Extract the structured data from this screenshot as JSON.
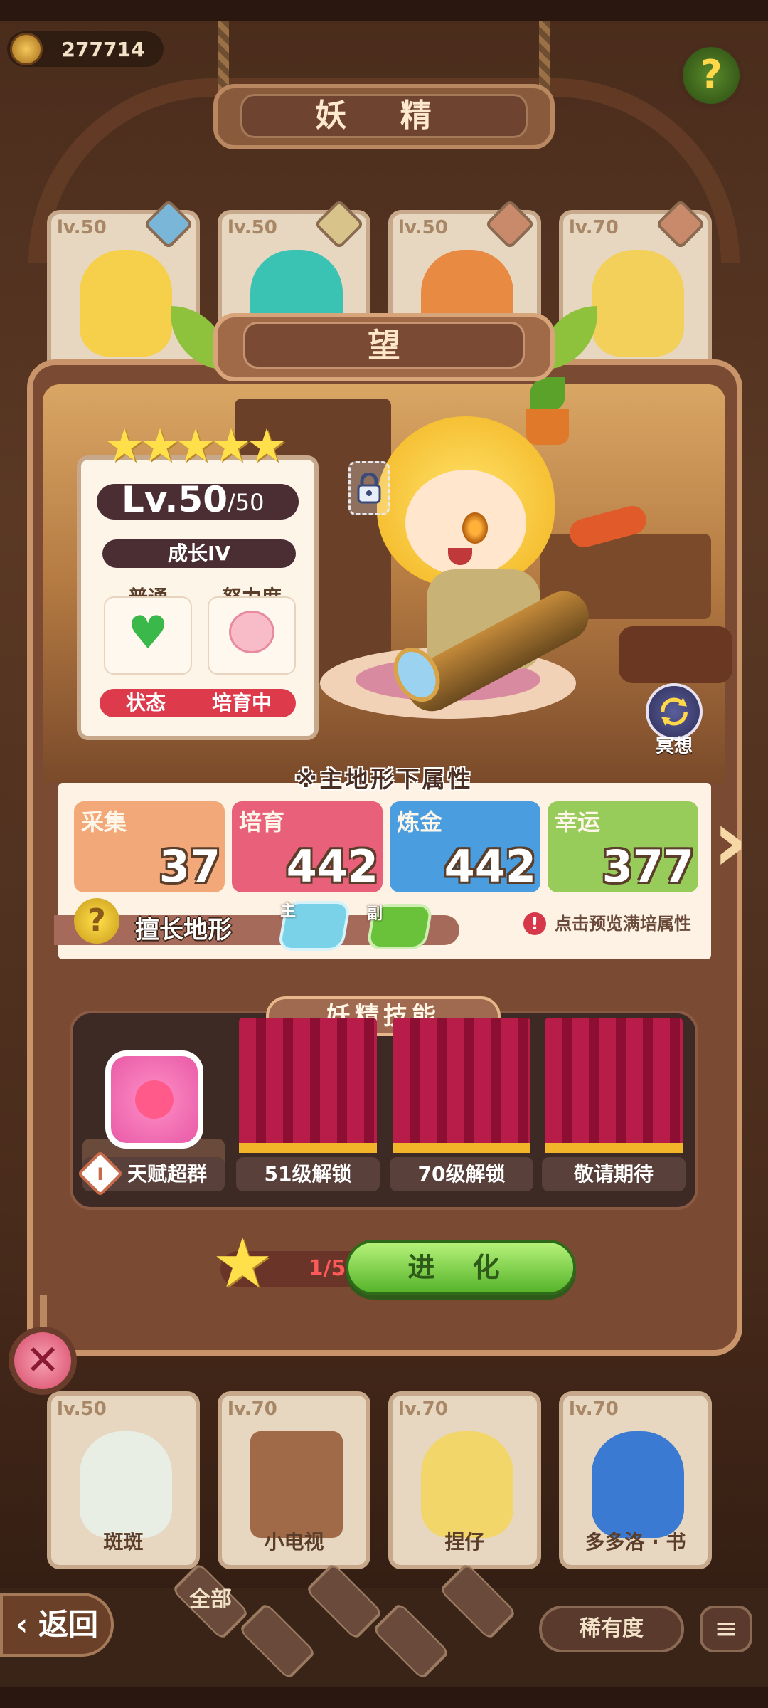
{
  "header": {
    "coins": "277714",
    "title": "妖 精",
    "help_icon": "question-mark-sprout-icon"
  },
  "background_cards_top": [
    {
      "level": "lv.50"
    },
    {
      "level": "lv.50"
    },
    {
      "level": "lv.50"
    },
    {
      "level": "lv.70"
    }
  ],
  "background_cards_bottom": [
    {
      "level": "lv.50",
      "name": "斑斑"
    },
    {
      "level": "lv.70",
      "name": "小电视"
    },
    {
      "level": "lv.70",
      "name": "捏仔"
    },
    {
      "level": "lv.70",
      "name": "多多洛 · 书"
    }
  ],
  "fairy": {
    "name": "望",
    "stars": 5,
    "level": "Lv.50",
    "level_max": "/50",
    "growth": "成长IV",
    "normal_label": "普通",
    "effort_label": "努力度",
    "status_label": "状态",
    "status_value": "培育中",
    "meditate_label": "冥想"
  },
  "attributes": {
    "title": "※主地形下属性",
    "items": [
      {
        "name": "采集",
        "value": "37",
        "color": "#f2a878"
      },
      {
        "name": "培育",
        "value": "442",
        "color": "#e8607a"
      },
      {
        "name": "炼金",
        "value": "442",
        "color": "#4a9ee0"
      },
      {
        "name": "幸运",
        "value": "377",
        "color": "#98cc5a"
      }
    ],
    "terrain_label": "擅长地形",
    "terrain_main_tag": "主",
    "terrain_sub_tag": "副",
    "preview_hint": "点击预览满培属性"
  },
  "skills": {
    "title": "妖精技能",
    "slots": [
      {
        "label": "天赋超群"
      },
      {
        "label": "51级解锁"
      },
      {
        "label": "70级解锁"
      },
      {
        "label": "敬请期待"
      }
    ]
  },
  "evolve": {
    "progress": "1/5",
    "button_label": "进 化"
  },
  "bottom_nav": {
    "back_label": "返回",
    "filter_all": "全部",
    "rarity_label": "稀有度"
  },
  "colors": {
    "accent_green": "#56b42a",
    "status_red": "#dd3a4c",
    "panel_brown": "#7a4a32"
  }
}
